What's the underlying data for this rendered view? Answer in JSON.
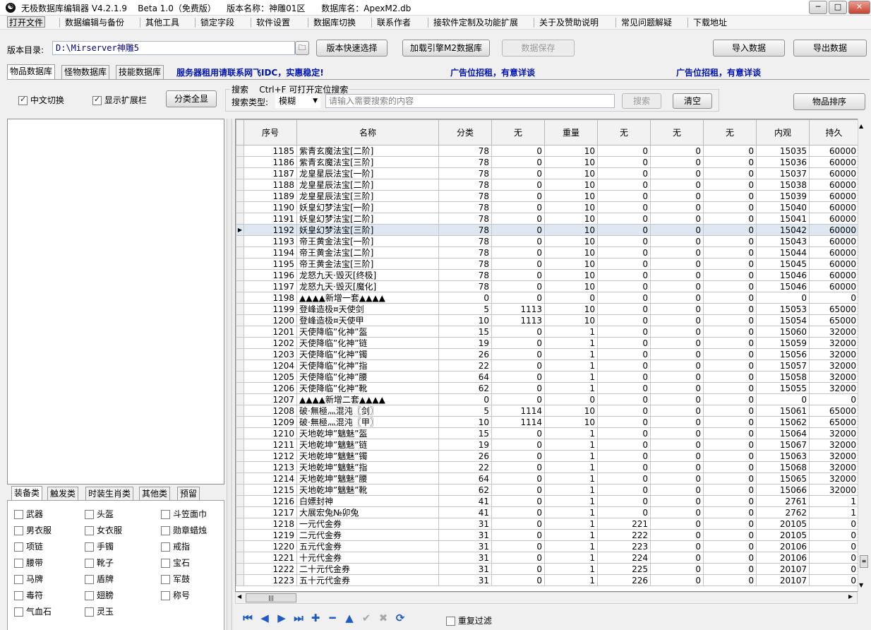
{
  "window": {
    "title": "无极数据库编辑器 V4.2.1.9    Beta 1.0（免费版）    版本名称：神雕01区      数据库名：ApexM2.db",
    "icon": "yin-yang-icon",
    "min": "─",
    "max": "□",
    "close": "✕"
  },
  "menu": [
    "打开文件",
    "数据编辑与备份",
    "其他工具",
    "锁定字段",
    "软件设置",
    "数据库切换",
    "联系作者",
    "接软件定制及功能扩展",
    "关于及赞助说明",
    "常见问题解疑",
    "下载地址"
  ],
  "toolbar": {
    "dir_label": "版本目录:",
    "dir_value": "D:\\Mirserver神雕5",
    "quick_select": "版本快速选择",
    "load_engine": "加载引擎M2数据库",
    "save": "数据保存",
    "import": "导入数据",
    "export": "导出数据"
  },
  "tabs": [
    "物品数据库",
    "怪物数据库",
    "技能数据库"
  ],
  "ads": [
    "服务器租用请联系网飞IDC，实惠稳定!",
    "广告位招租，有意详谈",
    "广告位招租，有意详谈"
  ],
  "options": {
    "chinese": "中文切换",
    "show_ext": "显示扩展栏",
    "show_all": "分类全显"
  },
  "search": {
    "title": "搜索    Ctrl+F 可打开定位搜索",
    "type_label": "搜索类型:",
    "type_value": "模糊",
    "placeholder": "请输入需要搜索的内容",
    "search_btn": "搜索",
    "clear_btn": "清空",
    "sort_btn": "物品排序"
  },
  "category_tabs": [
    "装备类",
    "触发类",
    "时装生肖类",
    "其他类",
    "预留"
  ],
  "categories": [
    "武器",
    "头盔",
    "斗笠面巾",
    "男衣服",
    "女衣服",
    "勋章蜡烛",
    "项链",
    "手镯",
    "戒指",
    "腰带",
    "靴子",
    "宝石",
    "马牌",
    "盾牌",
    "军鼓",
    "毒符",
    "翅膀",
    "称号",
    "气血石",
    "灵玉"
  ],
  "grid": {
    "columns": [
      "序号",
      "名称",
      "分类",
      "无",
      "重量",
      "无",
      "无",
      "无",
      "内观",
      "持久"
    ],
    "rows": [
      [
        "1185",
        "紫青玄魔法宝[二阶]",
        "78",
        "0",
        "10",
        "0",
        "0",
        "0",
        "15035",
        "60000"
      ],
      [
        "1186",
        "紫青玄魔法宝[三阶]",
        "78",
        "0",
        "10",
        "0",
        "0",
        "0",
        "15036",
        "60000"
      ],
      [
        "1187",
        "龙皇星辰法宝[一阶]",
        "78",
        "0",
        "10",
        "0",
        "0",
        "0",
        "15037",
        "60000"
      ],
      [
        "1188",
        "龙皇星辰法宝[二阶]",
        "78",
        "0",
        "10",
        "0",
        "0",
        "0",
        "15038",
        "60000"
      ],
      [
        "1189",
        "龙皇星辰法宝[三阶]",
        "78",
        "0",
        "10",
        "0",
        "0",
        "0",
        "15039",
        "60000"
      ],
      [
        "1190",
        "妖皇幻梦法宝[一阶]",
        "78",
        "0",
        "10",
        "0",
        "0",
        "0",
        "15040",
        "60000"
      ],
      [
        "1191",
        "妖皇幻梦法宝[二阶]",
        "78",
        "0",
        "10",
        "0",
        "0",
        "0",
        "15041",
        "60000"
      ],
      [
        "1192",
        "妖皇幻梦法宝[三阶]",
        "78",
        "0",
        "10",
        "0",
        "0",
        "0",
        "15042",
        "60000"
      ],
      [
        "1193",
        "帝王黄金法宝[一阶]",
        "78",
        "0",
        "10",
        "0",
        "0",
        "0",
        "15043",
        "60000"
      ],
      [
        "1194",
        "帝王黄金法宝[二阶]",
        "78",
        "0",
        "10",
        "0",
        "0",
        "0",
        "15044",
        "60000"
      ],
      [
        "1195",
        "帝王黄金法宝[三阶]",
        "78",
        "0",
        "10",
        "0",
        "0",
        "0",
        "15045",
        "60000"
      ],
      [
        "1196",
        "龙怒九天·毁灭[终极]",
        "78",
        "0",
        "10",
        "0",
        "0",
        "0",
        "15046",
        "60000"
      ],
      [
        "1197",
        "龙怒九天·毁灭[魔化]",
        "78",
        "0",
        "10",
        "0",
        "0",
        "0",
        "15046",
        "60000"
      ],
      [
        "1198",
        "▲▲▲▲新增一套▲▲▲▲",
        "0",
        "0",
        "0",
        "0",
        "0",
        "0",
        "0",
        "0"
      ],
      [
        "1199",
        "登峰造极¤天使剑",
        "5",
        "1113",
        "10",
        "0",
        "0",
        "0",
        "15053",
        "65000"
      ],
      [
        "1200",
        "登峰造极¤天使甲",
        "10",
        "1113",
        "10",
        "0",
        "0",
        "0",
        "15054",
        "65000"
      ],
      [
        "1201",
        "天使降临”化神”盔",
        "15",
        "0",
        "1",
        "0",
        "0",
        "0",
        "15060",
        "32000"
      ],
      [
        "1202",
        "天使降临”化神”链",
        "19",
        "0",
        "1",
        "0",
        "0",
        "0",
        "15059",
        "32000"
      ],
      [
        "1203",
        "天使降临”化神”镯",
        "26",
        "0",
        "1",
        "0",
        "0",
        "0",
        "15056",
        "32000"
      ],
      [
        "1204",
        "天使降临”化神”指",
        "22",
        "0",
        "1",
        "0",
        "0",
        "0",
        "15057",
        "32000"
      ],
      [
        "1205",
        "天使降临”化神”腰",
        "64",
        "0",
        "1",
        "0",
        "0",
        "0",
        "15058",
        "32000"
      ],
      [
        "1206",
        "天使降临”化神”靴",
        "62",
        "0",
        "1",
        "0",
        "0",
        "0",
        "15055",
        "32000"
      ],
      [
        "1207",
        "▲▲▲▲新增二套▲▲▲▲",
        "0",
        "0",
        "0",
        "0",
        "0",
        "0",
        "0",
        "0"
      ],
      [
        "1208",
        "破·無極灬混沌〖剑〗",
        "5",
        "1114",
        "10",
        "0",
        "0",
        "0",
        "15061",
        "65000"
      ],
      [
        "1209",
        "破·無極灬混沌〖甲〗",
        "10",
        "1114",
        "10",
        "0",
        "0",
        "0",
        "15062",
        "65000"
      ],
      [
        "1210",
        "天地乾坤”魑魅”盔",
        "15",
        "0",
        "1",
        "0",
        "0",
        "0",
        "15064",
        "32000"
      ],
      [
        "1211",
        "天地乾坤”魑魅”链",
        "19",
        "0",
        "1",
        "0",
        "0",
        "0",
        "15067",
        "32000"
      ],
      [
        "1212",
        "天地乾坤”魑魅”镯",
        "26",
        "0",
        "1",
        "0",
        "0",
        "0",
        "15063",
        "32000"
      ],
      [
        "1213",
        "天地乾坤”魑魅”指",
        "22",
        "0",
        "1",
        "0",
        "0",
        "0",
        "15068",
        "32000"
      ],
      [
        "1214",
        "天地乾坤”魑魅”腰",
        "64",
        "0",
        "1",
        "0",
        "0",
        "0",
        "15065",
        "32000"
      ],
      [
        "1215",
        "天地乾坤”魑魅”靴",
        "62",
        "0",
        "1",
        "0",
        "0",
        "0",
        "15066",
        "32000"
      ],
      [
        "1216",
        "白嫖封神",
        "41",
        "0",
        "1",
        "0",
        "0",
        "0",
        "2761",
        "1"
      ],
      [
        "1217",
        "大展宏兔№卯兔",
        "41",
        "0",
        "1",
        "0",
        "0",
        "0",
        "2762",
        "1"
      ],
      [
        "1218",
        "一元代金券",
        "31",
        "0",
        "1",
        "221",
        "0",
        "0",
        "20105",
        "0"
      ],
      [
        "1219",
        "二元代金券",
        "31",
        "0",
        "1",
        "222",
        "0",
        "0",
        "20105",
        "0"
      ],
      [
        "1220",
        "五元代金券",
        "31",
        "0",
        "1",
        "223",
        "0",
        "0",
        "20106",
        "0"
      ],
      [
        "1221",
        "十元代金券",
        "31",
        "0",
        "1",
        "224",
        "0",
        "0",
        "20106",
        "0"
      ],
      [
        "1222",
        "二十元代金券",
        "31",
        "0",
        "1",
        "225",
        "0",
        "0",
        "20107",
        "0"
      ],
      [
        "1223",
        "五十元代金券",
        "31",
        "0",
        "1",
        "226",
        "0",
        "0",
        "20107",
        "0"
      ]
    ],
    "selected_row": 7,
    "row_indicator": "▶"
  },
  "nav": {
    "icons": [
      "first-icon",
      "prev-icon",
      "next-icon",
      "last-icon",
      "insert-icon",
      "delete-icon",
      "edit-icon",
      "post-icon",
      "cancel-icon",
      "refresh-icon"
    ],
    "glyphs": [
      "⏮",
      "◀",
      "▶",
      "⏭",
      "✚",
      "━",
      "▲",
      "✔",
      "✖",
      "⟳"
    ],
    "repeat_filter": "重复过滤"
  }
}
